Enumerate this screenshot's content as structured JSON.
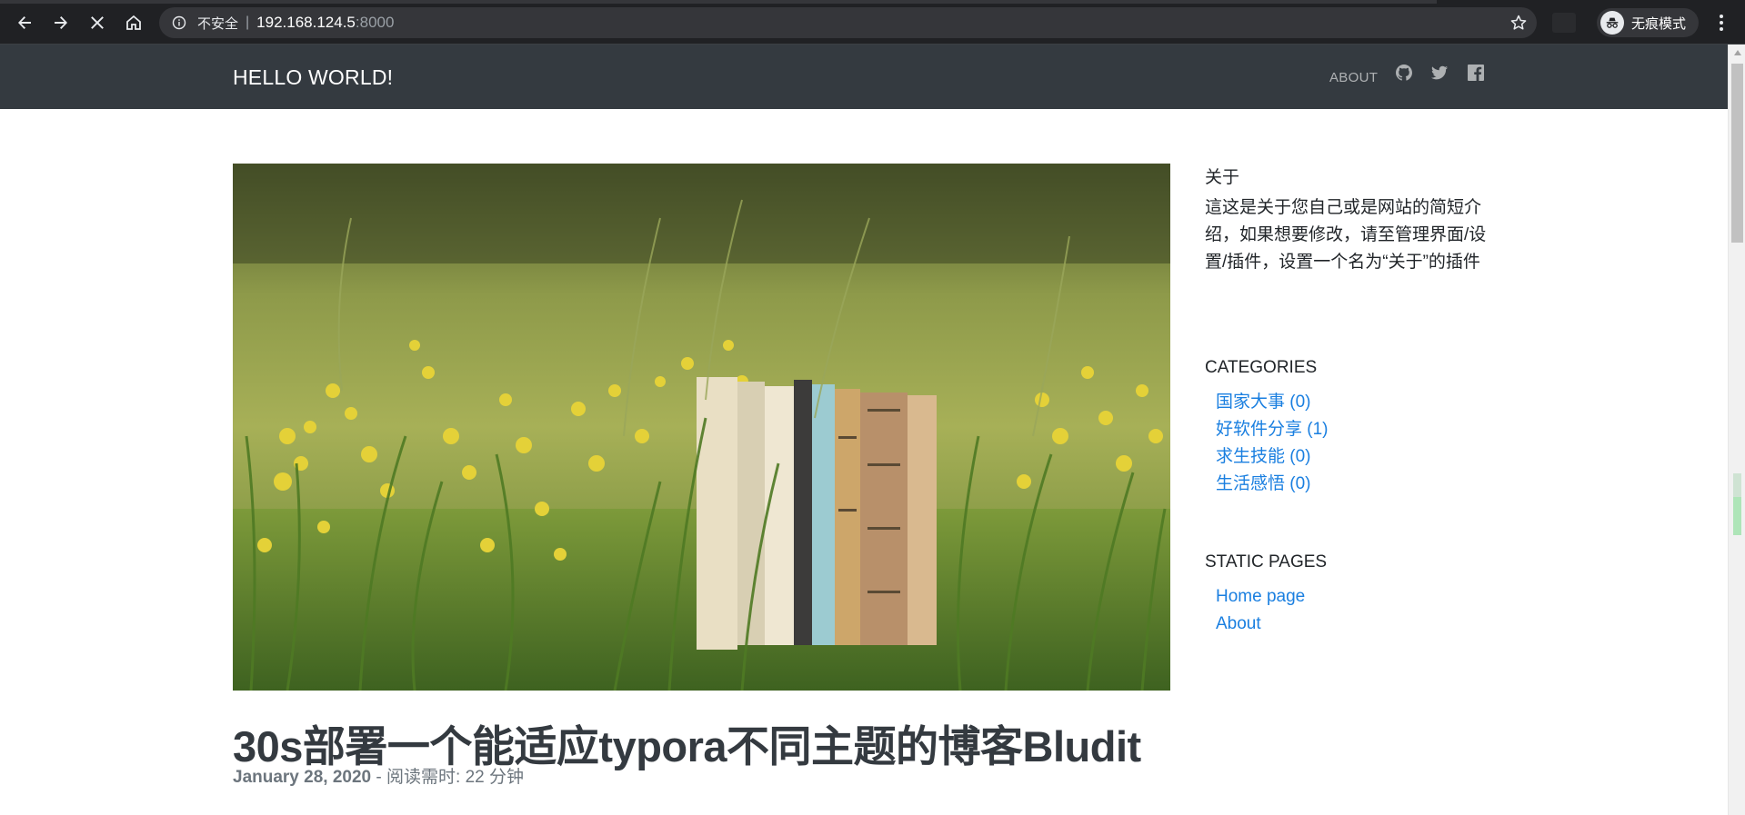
{
  "browser": {
    "security_label": "不安全",
    "separator": "|",
    "url_host": "192.168.124.5",
    "url_port": ":8000",
    "incognito_label": "无痕模式",
    "icons": {
      "back": "arrow-left-icon",
      "forward": "arrow-right-icon",
      "stop": "close-icon",
      "home": "home-icon",
      "info": "info-icon",
      "bookmark": "star-icon",
      "menu": "vertical-dots-icon"
    }
  },
  "site": {
    "brand": "HELLO WORLD!",
    "nav": {
      "about": "ABOUT",
      "social": [
        "github-icon",
        "twitter-icon",
        "facebook-icon"
      ]
    },
    "colors": {
      "navbar": "#343a40",
      "link": "#1a7fe0",
      "text": "#212529",
      "muted": "#6c757d"
    }
  },
  "post": {
    "image_description_icon": "hero-image",
    "title": "30s部署一个能适应typora不同主题的博客Bludit",
    "date": "January 28, 2020",
    "meta_separator": " - ",
    "reading_time": "阅读需时: 22 分钟"
  },
  "sidebar": {
    "about": {
      "title": "关于",
      "text": "這这是关于您自己或是网站的简短介绍，如果想要修改，请至管理界面/设置/插件，设置一个名为“关于”的插件"
    },
    "categories": {
      "title": "CATEGORIES",
      "items": [
        {
          "label": "国家大事 (0)"
        },
        {
          "label": "好软件分享 (1)"
        },
        {
          "label": "求生技能 (0)"
        },
        {
          "label": "生活感悟 (0)"
        }
      ]
    },
    "static_pages": {
      "title": "STATIC PAGES",
      "items": [
        {
          "label": "Home page"
        },
        {
          "label": "About"
        }
      ]
    }
  }
}
